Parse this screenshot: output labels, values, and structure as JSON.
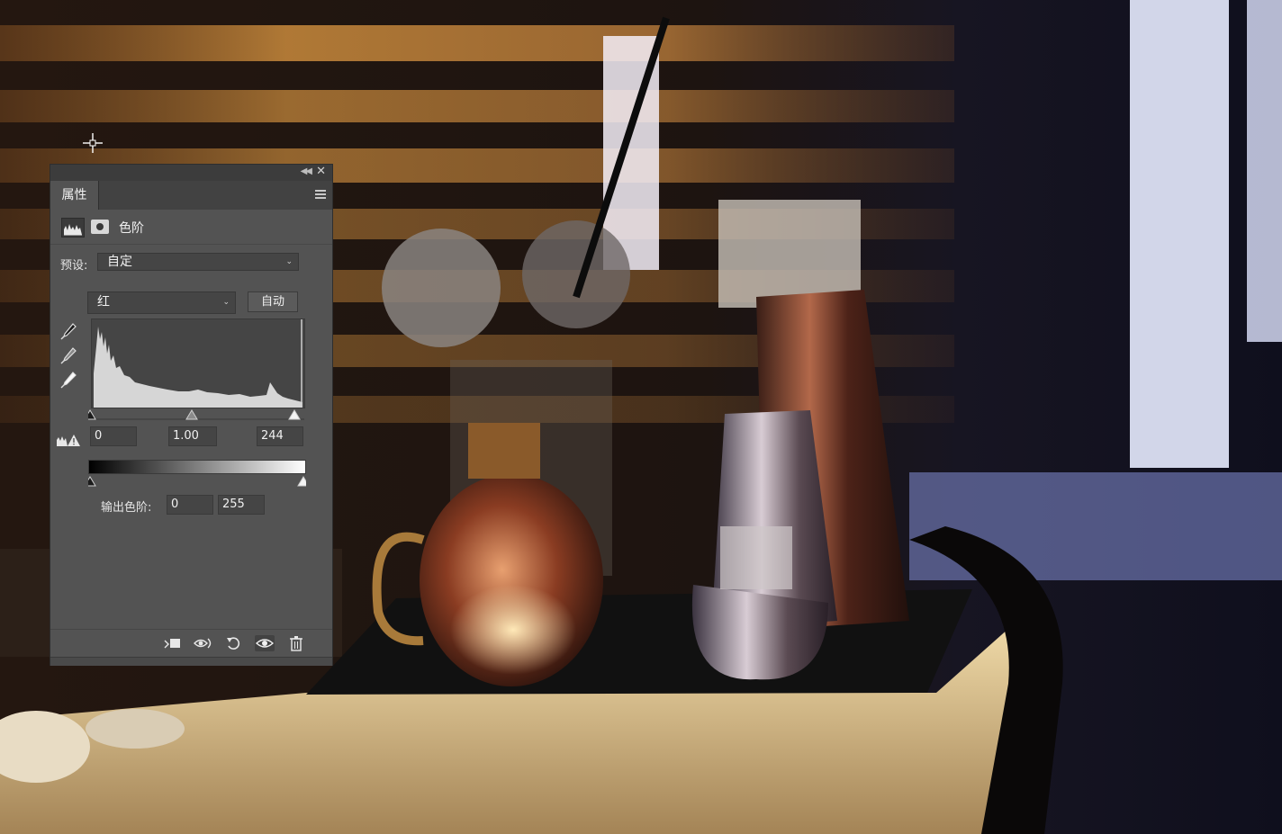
{
  "panel": {
    "tab_label": "属性",
    "adjustment_title": "色阶",
    "preset_label": "预设:",
    "preset_value": "自定",
    "channel_value": "红",
    "auto_button": "自动",
    "input_black": "0",
    "input_gamma": "1.00",
    "input_white": "244",
    "output_label": "输出色阶:",
    "output_black": "0",
    "output_white": "255"
  },
  "icons": {
    "panel_menu": "menu-icon",
    "histogram_adjustment": "levels-icon",
    "layer_mask": "mask-icon",
    "black_point_eyedropper": "eyedropper-black-icon",
    "gray_point_eyedropper": "eyedropper-gray-icon",
    "white_point_eyedropper": "eyedropper-white-icon",
    "clipping_warning": "clipping-warning-icon",
    "clip_to_layer": "clip-to-layer-icon",
    "view_previous_state": "view-previous-icon",
    "reset": "reset-icon",
    "toggle_visibility": "eye-icon",
    "delete": "trash-icon"
  }
}
